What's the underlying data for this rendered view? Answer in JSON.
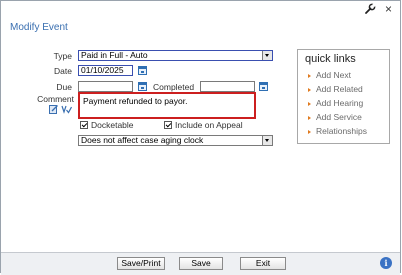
{
  "dialog": {
    "title": "Modify Event",
    "close_glyph": "×"
  },
  "form": {
    "type_label": "Type",
    "type_value": "Paid in Full - Auto",
    "date_label": "Date",
    "date_value": "01/10/2025",
    "due_label": "Due",
    "due_value": "",
    "completed_label": "Completed",
    "completed_value": "",
    "comment_label": "Comment",
    "comment_value": "Payment refunded to payor.",
    "docketable_label": "Docketable",
    "include_on_appeal_label": "Include on Appeal",
    "aging_value": "Does not affect case aging clock"
  },
  "quick_links": {
    "title": "quick links",
    "items": [
      {
        "label": "Add Next"
      },
      {
        "label": "Add Related"
      },
      {
        "label": "Add Hearing"
      },
      {
        "label": "Add Service"
      },
      {
        "label": "Relationships"
      }
    ]
  },
  "footer": {
    "save_print_label": "Save/Print",
    "save_label": "Save",
    "exit_label": "Exit",
    "info_glyph": "i"
  },
  "colors": {
    "accent": "#3a6fb0",
    "comment_border": "#cc1f1f",
    "link_arrow": "#e07a1f"
  },
  "icons": [
    "wrench-icon",
    "close-icon",
    "calendar-icon",
    "spellcheck-icon",
    "info-icon"
  ]
}
